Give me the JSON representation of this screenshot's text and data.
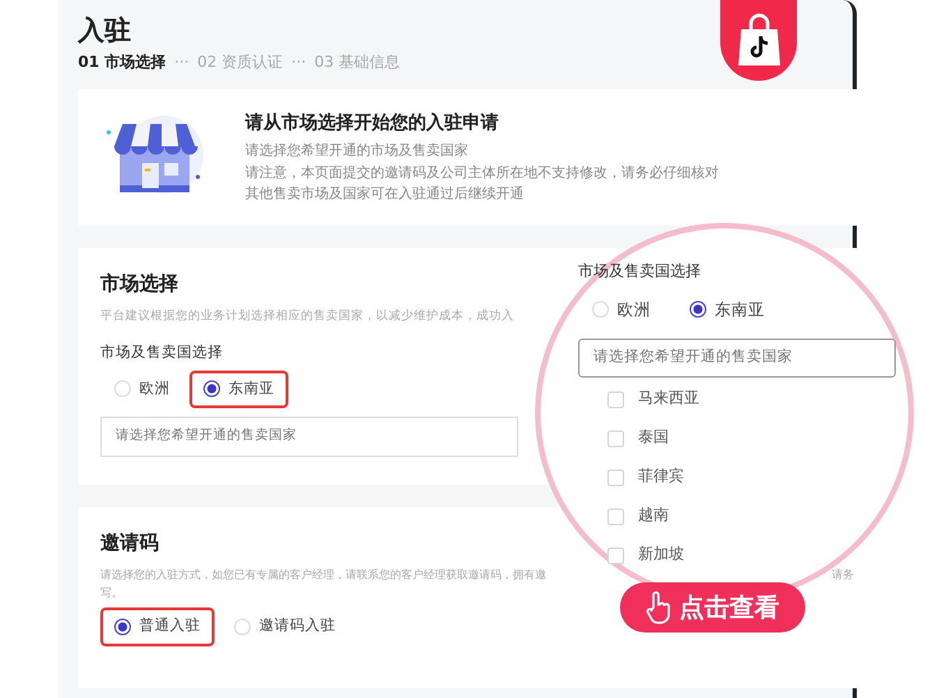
{
  "header": {
    "title": "入驻",
    "steps": [
      {
        "label": "01 市场选择",
        "selected": true
      },
      {
        "label": "02 资质认证",
        "selected": false
      },
      {
        "label": "03 基础信息",
        "selected": false
      }
    ],
    "separator": "···"
  },
  "intro": {
    "title": "请从市场选择开始您的入驻申请",
    "lines": [
      "请选择您希望开通的市场及售卖国家",
      "请注意，本页面提交的邀请码及公司主体所在地不支持修改，请务必仔细核对",
      "其他售卖市场及国家可在入驻通过后继续开通"
    ]
  },
  "market": {
    "title": "市场选择",
    "description": "平台建议根据您的业务计划选择相应的售卖国家，以减少维护成本，成功入",
    "field_label": "市场及售卖国选择",
    "options": [
      {
        "label": "欧洲",
        "selected": false,
        "highlighted": false
      },
      {
        "label": "东南亚",
        "selected": true,
        "highlighted": true
      }
    ],
    "placeholder": "请选择您希望开通的售卖国家"
  },
  "invite": {
    "title": "邀请码",
    "description": "请选择您的入驻方式，如您已有专属的客户经理，请联系您的客户经理获取邀请码，拥有邀",
    "description_right": "请务",
    "description_line2": "写。",
    "options": [
      {
        "label": "普通入驻",
        "selected": true,
        "highlighted": true
      },
      {
        "label": "邀请码入驻",
        "selected": false,
        "highlighted": false
      }
    ]
  },
  "magnifier": {
    "field_label": "市场及售卖国选择",
    "options": [
      {
        "label": "欧洲",
        "selected": false
      },
      {
        "label": "东南亚",
        "selected": true
      }
    ],
    "placeholder": "请选择您希望开通的售卖国家",
    "countries": [
      {
        "label": "马来西亚",
        "checked": false
      },
      {
        "label": "泰国",
        "checked": false
      },
      {
        "label": "菲律宾",
        "checked": false
      },
      {
        "label": "越南",
        "checked": false
      },
      {
        "label": "新加坡",
        "checked": false
      }
    ]
  },
  "cta": {
    "label": "点击查看"
  }
}
